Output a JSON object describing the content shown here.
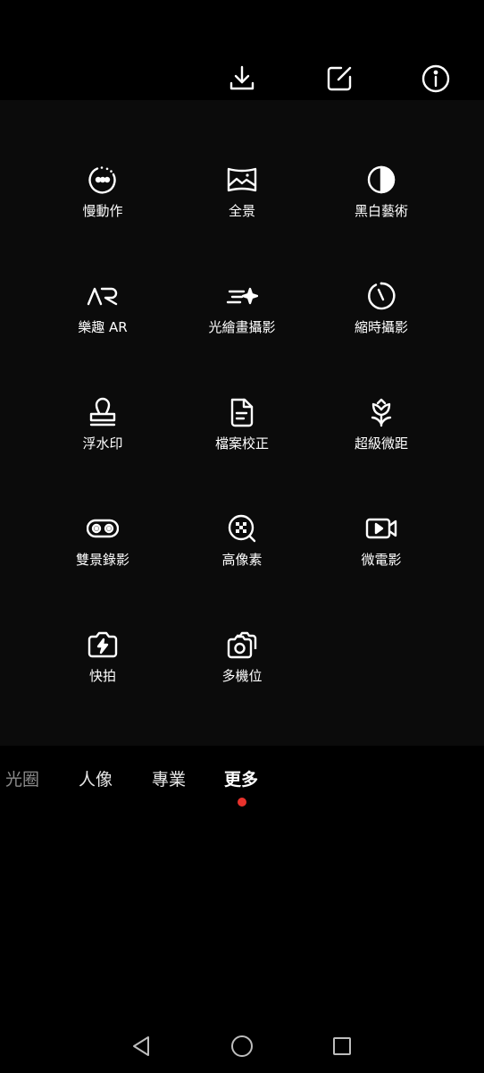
{
  "top_bar": {
    "download_icon": "download-icon",
    "edit_icon": "edit-icon",
    "info_icon": "info-icon"
  },
  "modes": [
    {
      "label": "慢動作",
      "icon": "slow-motion-icon"
    },
    {
      "label": "全景",
      "icon": "panorama-icon"
    },
    {
      "label": "黑白藝術",
      "icon": "monochrome-icon"
    },
    {
      "label": "樂趣 AR",
      "icon": "ar-icon"
    },
    {
      "label": "光繪畫攝影",
      "icon": "light-painting-icon"
    },
    {
      "label": "縮時攝影",
      "icon": "time-lapse-icon"
    },
    {
      "label": "浮水印",
      "icon": "watermark-stamp-icon"
    },
    {
      "label": "檔案校正",
      "icon": "document-scan-icon"
    },
    {
      "label": "超級微距",
      "icon": "super-macro-flower-icon"
    },
    {
      "label": "雙景錄影",
      "icon": "dual-view-icon"
    },
    {
      "label": "高像素",
      "icon": "high-resolution-icon"
    },
    {
      "label": "微電影",
      "icon": "micro-movie-icon"
    },
    {
      "label": "快拍",
      "icon": "snapshot-camera-icon"
    },
    {
      "label": "多機位",
      "icon": "multi-camera-icon"
    }
  ],
  "mode_tabs": [
    {
      "label": "光圈",
      "state": "faded"
    },
    {
      "label": "人像",
      "state": "normal"
    },
    {
      "label": "專業",
      "state": "normal"
    },
    {
      "label": "更多",
      "state": "active"
    }
  ],
  "colors": {
    "accent_dot": "#e8322c",
    "panel_bg": "#0b0b0b"
  },
  "nav_bar": {
    "back_icon": "back-triangle-icon",
    "home_icon": "home-circle-icon",
    "recents_icon": "recents-square-icon"
  }
}
